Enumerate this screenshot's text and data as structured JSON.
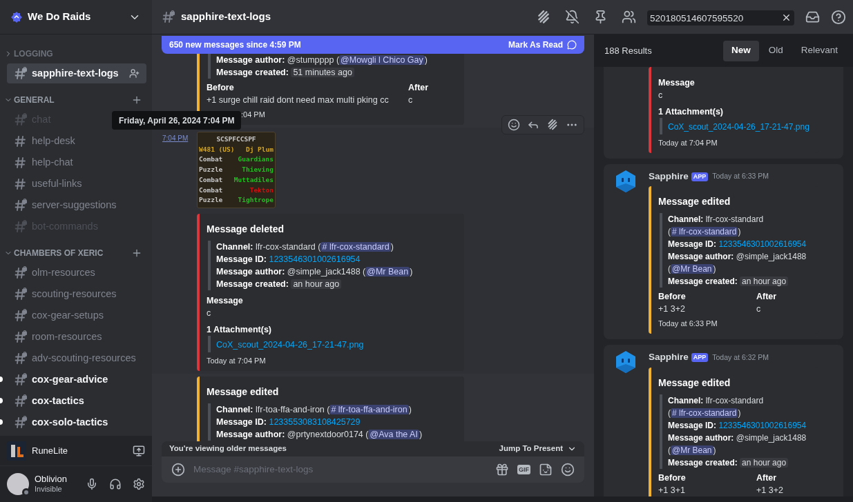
{
  "server": {
    "name": "We Do Raids"
  },
  "categories": [
    {
      "name": "LOGGING",
      "expanded": false,
      "channels": [
        {
          "name": "sapphire-text-logs",
          "kind": "locked",
          "selected": true,
          "unread": false,
          "muted": false
        }
      ]
    },
    {
      "name": "GENERAL",
      "expanded": true,
      "channels": [
        {
          "name": "chat",
          "kind": "locked",
          "selected": false,
          "unread": false,
          "muted": true
        },
        {
          "name": "help-desk",
          "kind": "text",
          "selected": false,
          "unread": false,
          "muted": false
        },
        {
          "name": "help-chat",
          "kind": "text",
          "selected": false,
          "unread": false,
          "muted": false
        },
        {
          "name": "useful-links",
          "kind": "text",
          "selected": false,
          "unread": false,
          "muted": false
        },
        {
          "name": "server-suggestions",
          "kind": "locked",
          "selected": false,
          "unread": false,
          "muted": false
        },
        {
          "name": "bot-commands",
          "kind": "locked",
          "selected": false,
          "unread": false,
          "muted": true
        }
      ]
    },
    {
      "name": "CHAMBERS OF XERIC",
      "expanded": true,
      "channels": [
        {
          "name": "olm-resources",
          "kind": "locked",
          "selected": false,
          "unread": false,
          "muted": false
        },
        {
          "name": "scouting-resources",
          "kind": "locked",
          "selected": false,
          "unread": false,
          "muted": false
        },
        {
          "name": "cox-gear-setups",
          "kind": "locked",
          "selected": false,
          "unread": false,
          "muted": false
        },
        {
          "name": "room-resources",
          "kind": "locked",
          "selected": false,
          "unread": false,
          "muted": false
        },
        {
          "name": "adv-scouting-resources",
          "kind": "locked",
          "selected": false,
          "unread": false,
          "muted": false
        },
        {
          "name": "cox-gear-advice",
          "kind": "locked",
          "selected": false,
          "unread": true,
          "muted": false
        },
        {
          "name": "cox-tactics",
          "kind": "locked",
          "selected": false,
          "unread": true,
          "muted": false
        },
        {
          "name": "cox-solo-tactics",
          "kind": "locked",
          "selected": false,
          "unread": true,
          "muted": false
        }
      ]
    }
  ],
  "activity": {
    "name": "RuneLite"
  },
  "user": {
    "name": "Oblivion",
    "status": "Invisible"
  },
  "header": {
    "channel": "sapphire-text-logs",
    "search": {
      "value": "520180514607595520"
    }
  },
  "new_messages": {
    "text": "650 new messages since 4:59 PM",
    "action": "Mark As Read"
  },
  "tooltip": "Friday, April 26, 2024 7:04 PM",
  "messages": [
    {
      "hovered": false,
      "embeds": [
        {
          "kind": "edited",
          "fields": [
            {
              "label": "Message author:",
              "parts": [
                {
                  "text": "@stumpppp ("
                },
                {
                  "mention": "@Mowgli l Chico Gay"
                },
                {
                  "text": ")"
                }
              ]
            },
            {
              "label": "Message created:",
              "parts": [
                {
                  "code": "51 minutes ago"
                }
              ]
            }
          ],
          "columns": [
            {
              "heading": "Before",
              "text": "+1 surge chill raid dont need max multi pking cc"
            },
            {
              "heading": "After",
              "text": "c"
            }
          ],
          "footer": ":04 PM"
        }
      ]
    },
    {
      "hovered": true,
      "time": "7:04 PM",
      "image": {
        "title": "SCSPFCCSPF",
        "rows": [
          {
            "kind": "world",
            "left": "W481 (US)",
            "right": "Dj Plum",
            "color": "#d4a51c"
          },
          {
            "kind": "room",
            "left": "Combat",
            "right": "Guardians",
            "color": "#1fbf1f"
          },
          {
            "kind": "room",
            "left": "Puzzle",
            "right": "Thieving",
            "color": "#1fbf1f"
          },
          {
            "kind": "room",
            "left": "Combat",
            "right": "Muttadiles",
            "color": "#1fbf1f"
          },
          {
            "kind": "room",
            "left": "Combat",
            "right": "Tekton",
            "color": "#d01010"
          },
          {
            "kind": "room",
            "left": "Puzzle",
            "right": "Tightrope",
            "color": "#1fbf1f"
          }
        ]
      },
      "embeds": [
        {
          "kind": "deleted",
          "title": "Message deleted",
          "fields": [
            {
              "label": "Channel:",
              "parts": [
                {
                  "text": "lfr-cox-standard ("
                },
                {
                  "mention": "# lfr-cox-standard"
                },
                {
                  "text": ")"
                }
              ]
            },
            {
              "label": "Message ID:",
              "parts": [
                {
                  "link": "1233546301002616954"
                }
              ]
            },
            {
              "label": "Message author:",
              "parts": [
                {
                  "text": "@simple_jack1488 ("
                },
                {
                  "mention": "@Mr Bean"
                },
                {
                  "text": ")"
                }
              ]
            },
            {
              "label": "Message created:",
              "parts": [
                {
                  "code": "an hour ago"
                }
              ]
            }
          ],
          "sections": [
            {
              "heading": "Message",
              "text": "c"
            },
            {
              "heading": "1 Attachment(s)",
              "link": "CoX_scout_2024-04-26_17-21-47.png"
            }
          ],
          "footer": "Today at 7:04 PM"
        }
      ]
    },
    {
      "hovered": false,
      "embeds": [
        {
          "kind": "edited",
          "title": "Message edited",
          "fields": [
            {
              "label": "Channel:",
              "parts": [
                {
                  "text": "lfr-toa-ffa-and-iron ("
                },
                {
                  "mention": "# lfr-toa-ffa-and-iron"
                },
                {
                  "text": ")"
                }
              ]
            },
            {
              "label": "Message ID:",
              "parts": [
                {
                  "link": "1233553083108425729"
                }
              ]
            },
            {
              "label": "Message author:",
              "parts": [
                {
                  "text": "@prtynextdoor0174 ("
                },
                {
                  "mention": "@Ava the AI"
                },
                {
                  "text": ")"
                }
              ]
            }
          ]
        }
      ]
    }
  ],
  "older_bar": {
    "text": "You're viewing older messages",
    "action": "Jump To Present"
  },
  "composer": {
    "placeholder": "Message #sapphire-text-logs",
    "gif_label": "GIF"
  },
  "results": {
    "count": "188 Results",
    "sorts": [
      {
        "label": "New",
        "selected": true
      },
      {
        "label": "Old",
        "selected": false
      },
      {
        "label": "Relevant",
        "selected": false
      }
    ],
    "items": [
      {
        "embeds": [
          {
            "kind": "deleted",
            "sections": [
              {
                "heading": "Message",
                "text": "c"
              },
              {
                "heading": "1 Attachment(s)",
                "link": "CoX_scout_2024-04-26_17-21-47.png"
              }
            ],
            "footer": "Today at 7:04 PM"
          }
        ]
      },
      {
        "author": "Sapphire",
        "badge": "APP",
        "time": "Today at 6:33 PM",
        "embeds": [
          {
            "kind": "edited",
            "title": "Message edited",
            "fields": [
              {
                "label": "Channel:",
                "parts": [
                  {
                    "text": "lfr-cox-standard ("
                  },
                  {
                    "mention": "# lfr-cox-standard"
                  },
                  {
                    "text": ")"
                  }
                ]
              },
              {
                "label": "Message ID:",
                "parts": [
                  {
                    "link": "1233546301002616954"
                  }
                ]
              },
              {
                "label": "Message author:",
                "parts": [
                  {
                    "text": "@simple_jack1488 ("
                  },
                  {
                    "mention": "@Mr Bean"
                  },
                  {
                    "text": ")"
                  }
                ]
              },
              {
                "label": "Message created:",
                "parts": [
                  {
                    "code": "an hour ago"
                  }
                ]
              }
            ],
            "columns": [
              {
                "heading": "Before",
                "text": "+1 3+2"
              },
              {
                "heading": "After",
                "text": "c"
              }
            ],
            "footer": "Today at 6:33 PM"
          }
        ]
      },
      {
        "author": "Sapphire",
        "badge": "APP",
        "time": "Today at 6:32 PM",
        "embeds": [
          {
            "kind": "edited",
            "title": "Message edited",
            "fields": [
              {
                "label": "Channel:",
                "parts": [
                  {
                    "text": "lfr-cox-standard ("
                  },
                  {
                    "mention": "# lfr-cox-standard"
                  },
                  {
                    "text": ")"
                  }
                ]
              },
              {
                "label": "Message ID:",
                "parts": [
                  {
                    "link": "1233546301002616954"
                  }
                ]
              },
              {
                "label": "Message author:",
                "parts": [
                  {
                    "text": "@simple_jack1488 ("
                  },
                  {
                    "mention": "@Mr Bean"
                  },
                  {
                    "text": ")"
                  }
                ]
              },
              {
                "label": "Message created:",
                "parts": [
                  {
                    "code": "an hour ago"
                  }
                ]
              }
            ],
            "columns": [
              {
                "heading": "Before",
                "text": "+1 3+1"
              },
              {
                "heading": "After",
                "text": "+1 3+2"
              }
            ]
          }
        ]
      }
    ]
  }
}
